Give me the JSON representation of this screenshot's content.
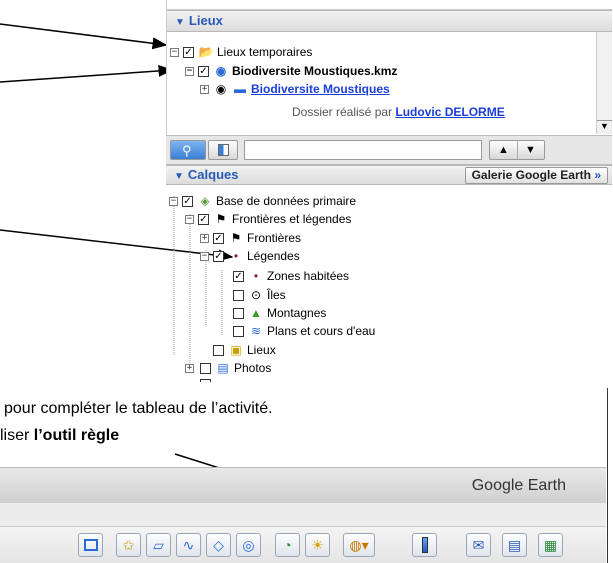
{
  "places": {
    "header": "Lieux",
    "items": [
      {
        "label": "Lieux temporaires"
      },
      {
        "label": "Biodiversite Moustiques.kmz"
      },
      {
        "label": "Biodiversite Moustiques"
      }
    ],
    "credit_prefix": "Dossier réalisé par ",
    "credit_link": "Ludovic DELORME"
  },
  "search": {
    "value": ""
  },
  "layers": {
    "header": "Calques",
    "gallery_button": "Galerie Google Earth",
    "gallery_arrow": "»",
    "items": [
      {
        "label": "Base de données primaire"
      },
      {
        "label": "Frontières et légendes"
      },
      {
        "label": "Frontières"
      },
      {
        "label": "Légendes"
      },
      {
        "label": "Zones habitées"
      },
      {
        "label": "Îles"
      },
      {
        "label": "Montagnes"
      },
      {
        "label": "Plans et cours d'eau"
      },
      {
        "label": "Lieux"
      },
      {
        "label": "Photos"
      }
    ]
  },
  "captions": {
    "line1": "pour compléter le tableau de l’activité.",
    "line2_prefix": "liser ",
    "line2_bold": "l’outil règle"
  },
  "app": {
    "title": "Google Earth"
  },
  "toolbar": {
    "icons": [
      "sidebar-icon",
      "placemark-icon",
      "polygon-icon",
      "path-icon",
      "overlay-icon",
      "tour-icon",
      "history-icon",
      "sunlight-icon",
      "planet-icon",
      "ruler-icon",
      "email-icon",
      "print-icon",
      "view-in-maps-icon"
    ]
  }
}
